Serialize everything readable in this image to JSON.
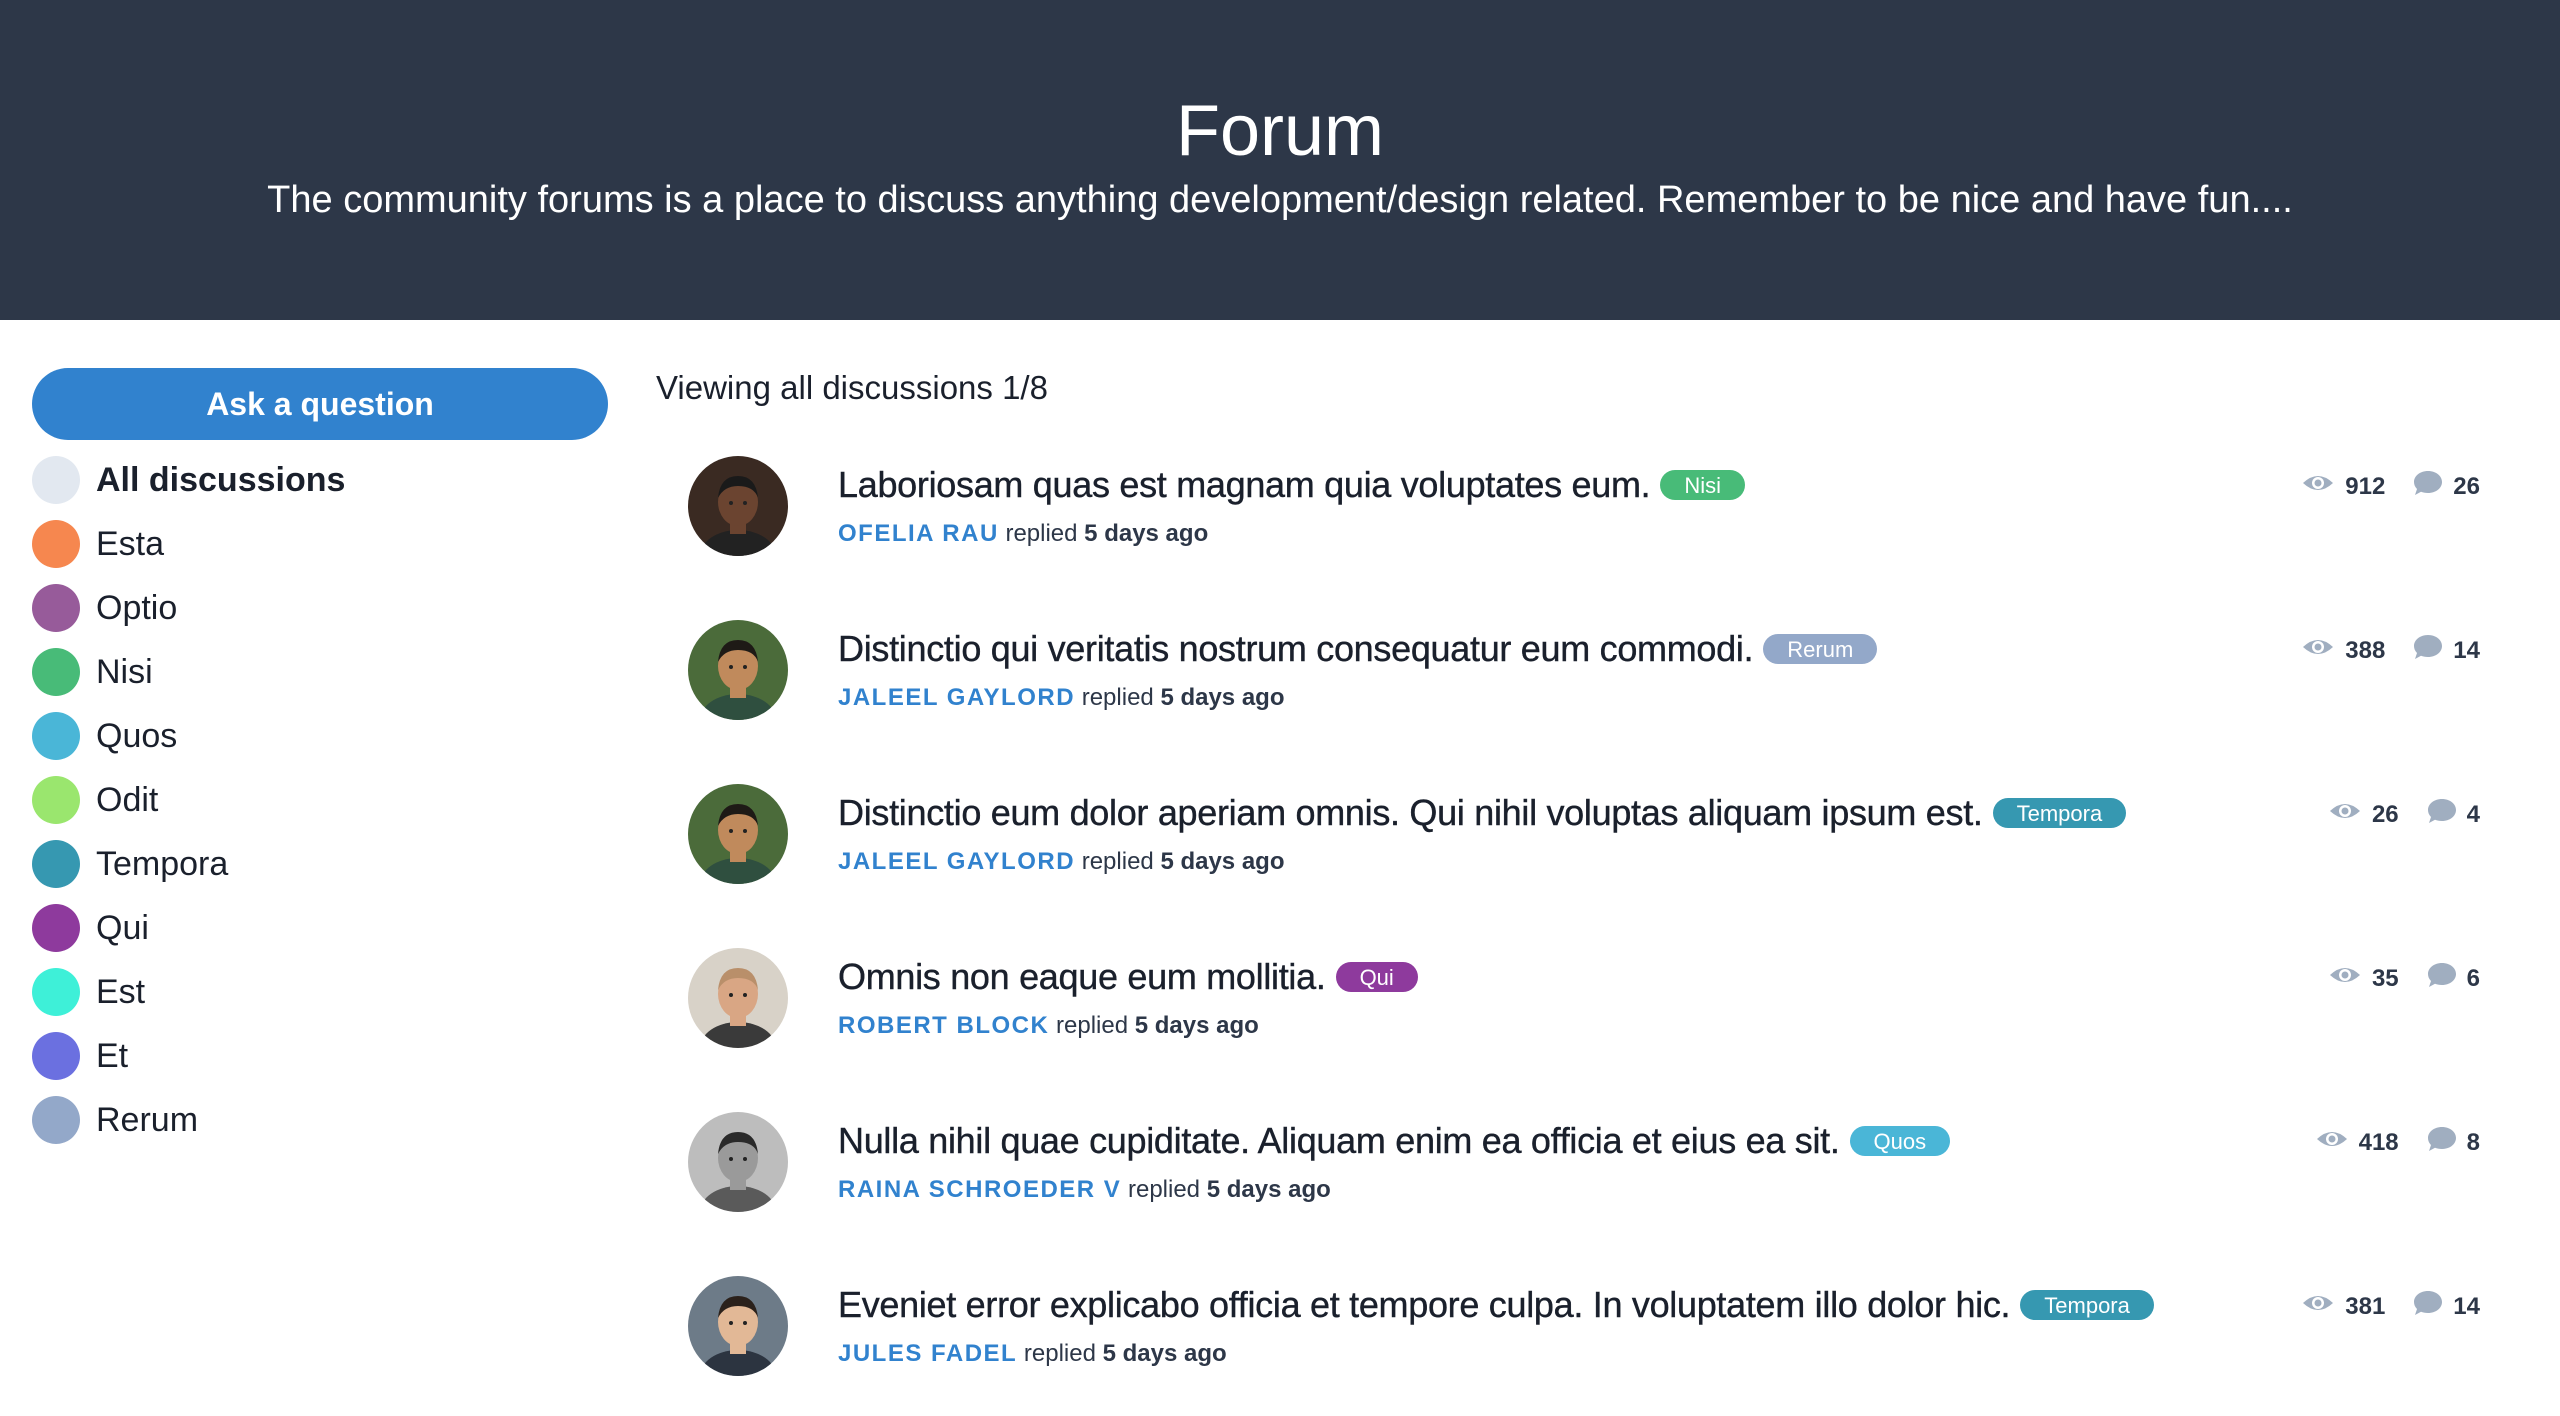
{
  "hero": {
    "title": "Forum",
    "subtitle": "The community forums is a place to discuss anything development/design related. Remember to be nice and have fun...."
  },
  "sidebar": {
    "ask_button": "Ask a question",
    "categories": [
      {
        "label": "All discussions",
        "color": "#e2e8f0"
      },
      {
        "label": "Esta",
        "color": "#f6874f"
      },
      {
        "label": "Optio",
        "color": "#975b9a"
      },
      {
        "label": "Nisi",
        "color": "#48bb78"
      },
      {
        "label": "Quos",
        "color": "#4ab6d7"
      },
      {
        "label": "Odit",
        "color": "#9ae66e"
      },
      {
        "label": "Tempora",
        "color": "#3698b1"
      },
      {
        "label": "Qui",
        "color": "#8e3a9d"
      },
      {
        "label": "Est",
        "color": "#3ef0d8"
      },
      {
        "label": "Et",
        "color": "#6b70e0"
      },
      {
        "label": "Rerum",
        "color": "#93a8c9"
      }
    ]
  },
  "main": {
    "viewing": "Viewing all discussions 1/8",
    "threads": [
      {
        "title": "Laboriosam quas est magnam quia voluptates eum.",
        "tag": "Nisi",
        "tag_color": "#48bb78",
        "author": "OFELIA RAU",
        "replied": "replied",
        "when": "5 days ago",
        "views": "912",
        "comments": "26",
        "avatar": "avatar-1"
      },
      {
        "title": "Distinctio qui veritatis nostrum consequatur eum commodi.",
        "tag": "Rerum",
        "tag_color": "#93a8c9",
        "author": "JALEEL GAYLORD",
        "replied": "replied",
        "when": "5 days ago",
        "views": "388",
        "comments": "14",
        "avatar": "avatar-2"
      },
      {
        "title": "Distinctio eum dolor aperiam omnis. Qui nihil voluptas aliquam ipsum est.",
        "tag": "Tempora",
        "tag_color": "#3698b1",
        "author": "JALEEL GAYLORD",
        "replied": "replied",
        "when": "5 days ago",
        "views": "26",
        "comments": "4",
        "avatar": "avatar-2"
      },
      {
        "title": "Omnis non eaque eum mollitia.",
        "tag": "Qui",
        "tag_color": "#8e3a9d",
        "author": "ROBERT BLOCK",
        "replied": "replied",
        "when": "5 days ago",
        "views": "35",
        "comments": "6",
        "avatar": "avatar-3"
      },
      {
        "title": "Nulla nihil quae cupiditate. Aliquam enim ea officia et eius ea sit.",
        "tag": "Quos",
        "tag_color": "#4ab6d7",
        "author": "RAINA SCHROEDER V",
        "replied": "replied",
        "when": "5 days ago",
        "views": "418",
        "comments": "8",
        "avatar": "avatar-4"
      },
      {
        "title": "Eveniet error explicabo officia et tempore culpa. In voluptatem illo dolor hic.",
        "tag": "Tempora",
        "tag_color": "#3698b1",
        "author": "JULES FADEL",
        "replied": "replied",
        "when": "5 days ago",
        "views": "381",
        "comments": "14",
        "avatar": "avatar-5"
      }
    ]
  },
  "icons": {
    "views": "eye-icon",
    "comments": "comment-bubble-icon"
  },
  "colors": {
    "header_bg": "#2d3748",
    "accent": "#3182ce",
    "icon_gray": "#a0aec0"
  }
}
